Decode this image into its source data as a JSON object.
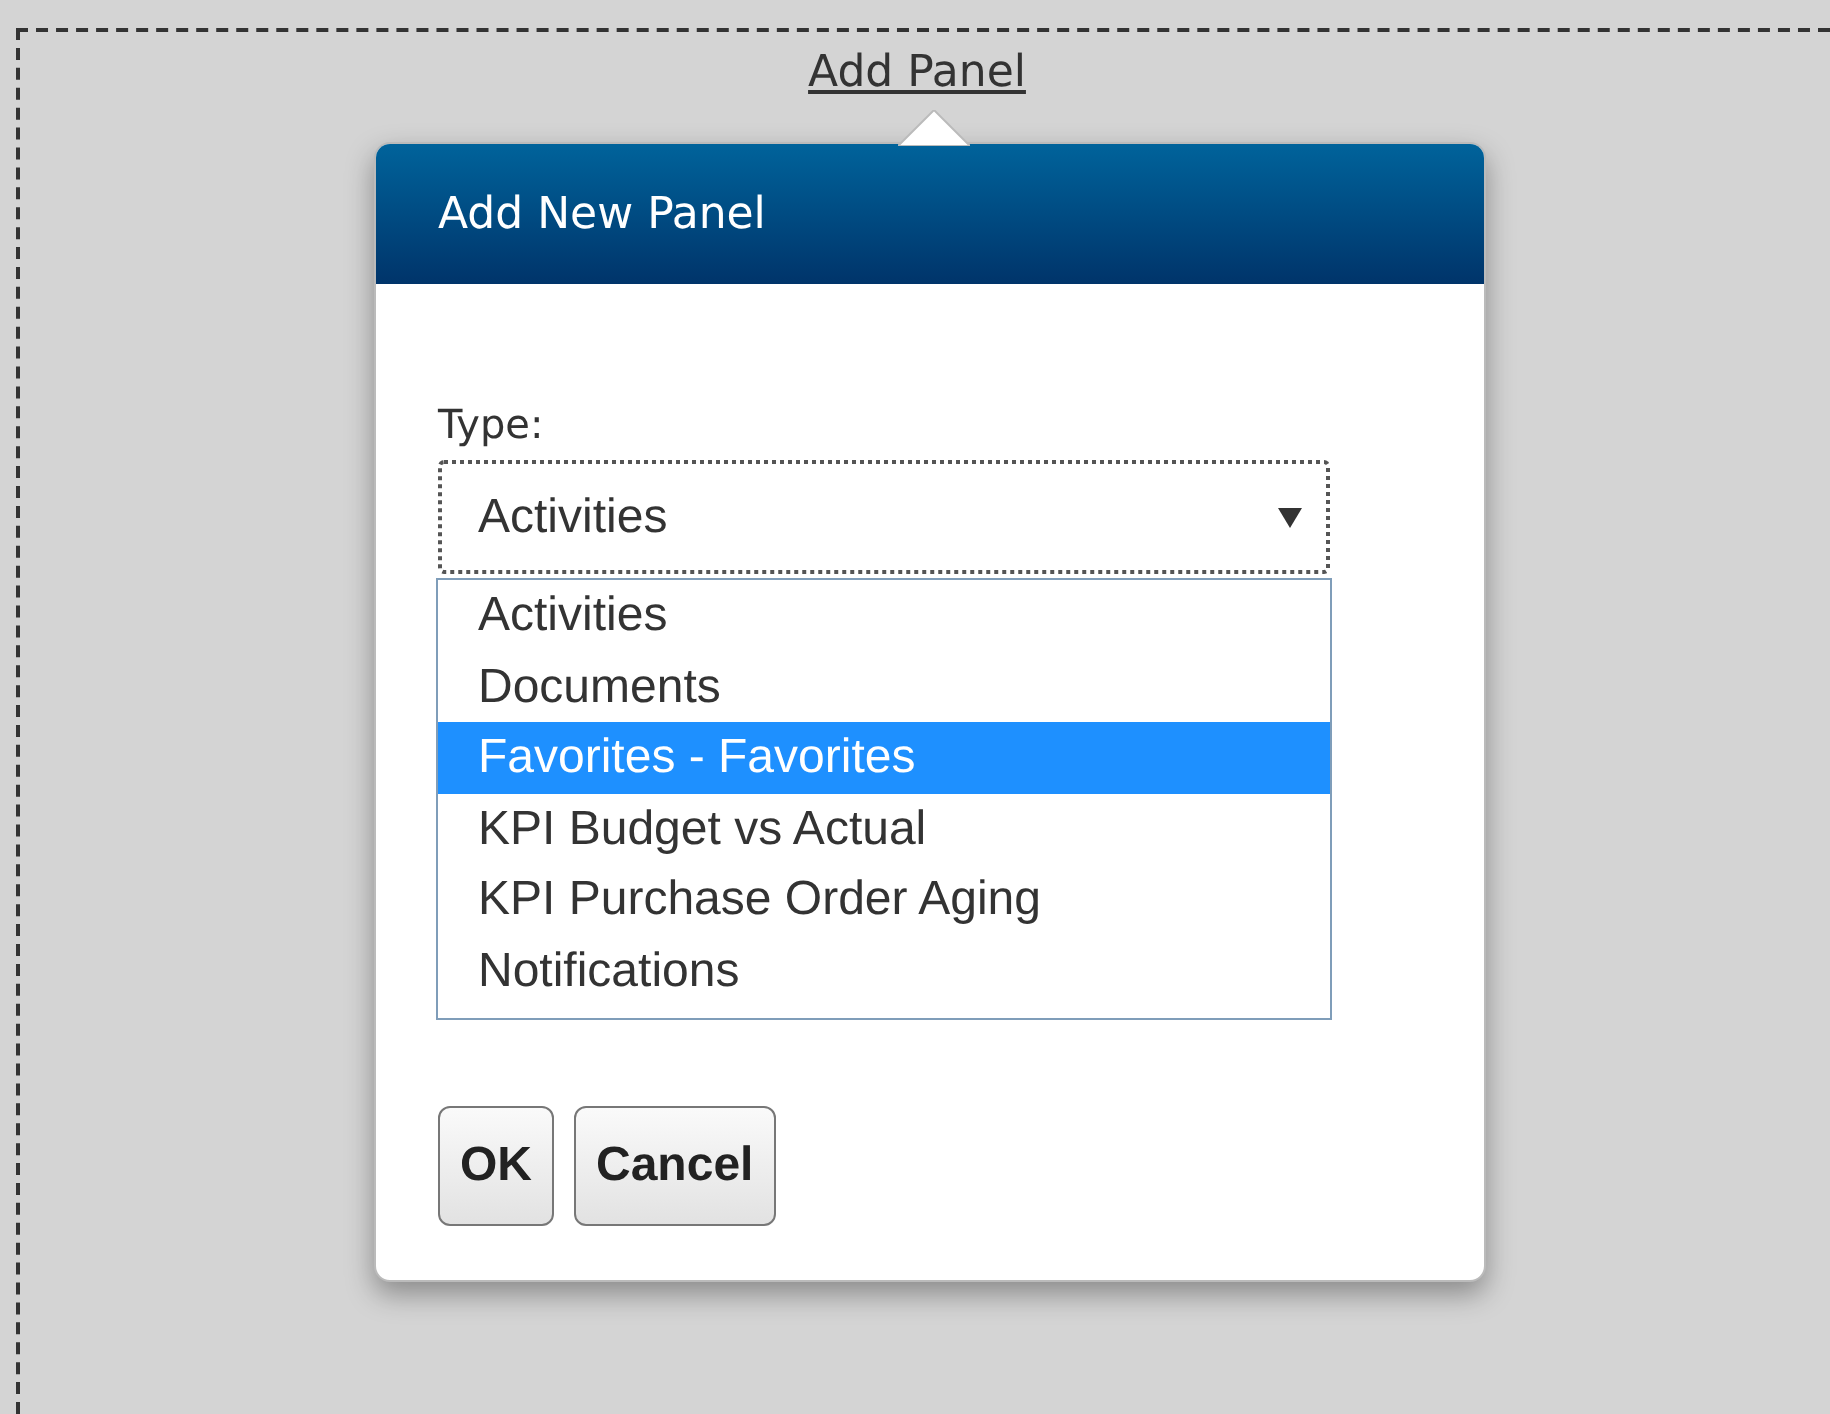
{
  "link": "Add Panel",
  "dialog": {
    "title": "Add New Panel",
    "type_field": {
      "label": "Type:",
      "value": "Activities",
      "expanded": true,
      "options": [
        {
          "label": "Activities",
          "highlighted": false
        },
        {
          "label": "Documents",
          "highlighted": false
        },
        {
          "label": "Favorites - Favorites",
          "highlighted": true
        },
        {
          "label": "KPI Budget vs Actual",
          "highlighted": false
        },
        {
          "label": "KPI Purchase Order Aging",
          "highlighted": false
        },
        {
          "label": "Notifications",
          "highlighted": false
        }
      ]
    },
    "buttons": [
      "OK",
      "Cancel"
    ]
  }
}
